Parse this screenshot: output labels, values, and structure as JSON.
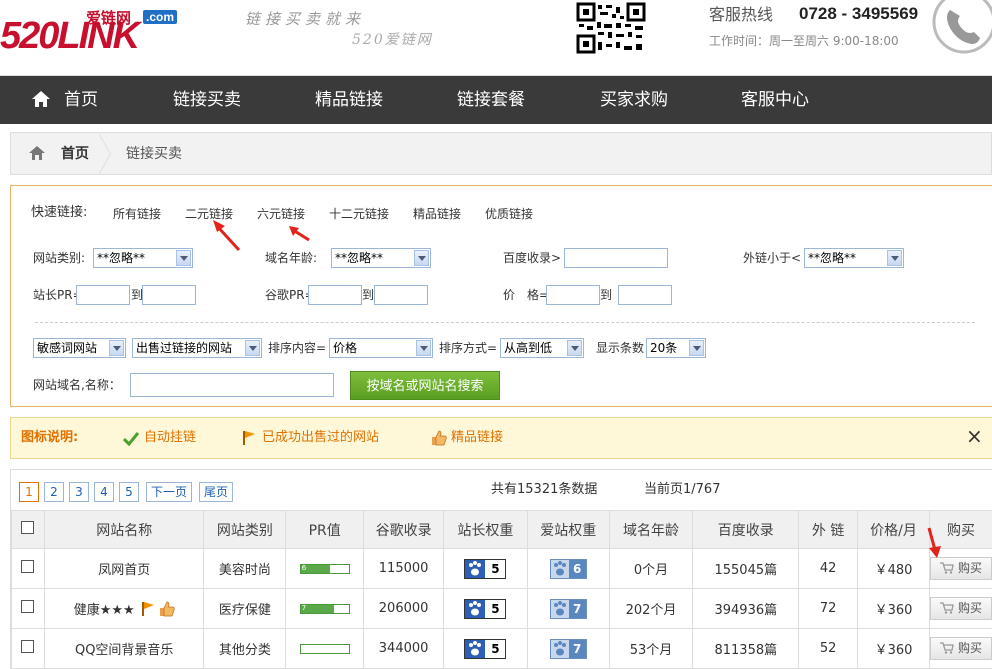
{
  "header": {
    "logo_main": "520LINK",
    "logo_cn": "爱链网",
    "logo_com": ".com",
    "slogan1": "链接买卖就来",
    "slogan2": "520爱链网",
    "hotline_label": "客服热线",
    "hotline_number": "0728 - 3495569",
    "work_time": "工作时间：周一至周六 9:00-18:00"
  },
  "nav": {
    "items": [
      {
        "label": "首页"
      },
      {
        "label": "链接买卖"
      },
      {
        "label": "精品链接"
      },
      {
        "label": "链接套餐"
      },
      {
        "label": "买家求购"
      },
      {
        "label": "客服中心"
      }
    ]
  },
  "breadcrumb": {
    "home": "首页",
    "current": "链接买卖"
  },
  "filter": {
    "quick_label": "快速链接:",
    "quick_links": [
      "所有链接",
      "二元链接",
      "六元链接",
      "十二元链接",
      "精品链接",
      "优质链接"
    ],
    "site_category_label": "网站类别:",
    "site_category_value": "**忽略**",
    "domain_age_label": "域名年龄:",
    "domain_age_value": "**忽略**",
    "baidu_index_label": "百度收录>",
    "outlinks_label": "外链小于<",
    "outlinks_value": "**忽略**",
    "pr_label": "站长PR=",
    "google_pr_label": "谷歌PR=",
    "price_label": "价　格=",
    "to": "到",
    "sensitive_value": "敏感词网站",
    "sold_value": "出售过链接的网站",
    "sort_content_label": "排序内容=",
    "sort_content_value": "价格",
    "sort_way_label": "排序方式=",
    "sort_way_value": "从高到低",
    "show_count_label": "显示条数",
    "show_count_value": "20条",
    "domain_label": "网站域名,名称：",
    "search_button": "按域名或网站名搜索"
  },
  "legend": {
    "title": "图标说明:",
    "items": [
      "自动挂链",
      "已成功出售过的网站",
      "精品链接"
    ],
    "close": "×"
  },
  "pagination": {
    "pages": [
      "1",
      "2",
      "3",
      "4",
      "5"
    ],
    "next": "下一页",
    "last": "尾页",
    "total": "共有15321条数据",
    "current": "当前页1/767"
  },
  "table": {
    "headers": [
      "网站名称",
      "网站类别",
      "PR值",
      "谷歌收录",
      "站长权重",
      "爱站权重",
      "域名年龄",
      "百度收录",
      "外 链",
      "价格/月",
      "购买"
    ],
    "buy_label": "购买",
    "rows": [
      {
        "name": "凤网首页",
        "category": "美容时尚",
        "pr": 6,
        "google": "115000",
        "bd_weight": "5",
        "az_weight": "6",
        "age": "0个月",
        "baidu": "155045篇",
        "links": "42",
        "price": "￥480"
      },
      {
        "name": "健康★★★",
        "category": "医疗保健",
        "pr": 7,
        "google": "206000",
        "bd_weight": "5",
        "az_weight": "7",
        "age": "202个月",
        "baidu": "394936篇",
        "links": "72",
        "price": "￥360"
      },
      {
        "name": "QQ空间背景音乐",
        "category": "其他分类",
        "pr": 0,
        "google": "344000",
        "bd_weight": "5",
        "az_weight": "7",
        "age": "53个月",
        "baidu": "811358篇",
        "links": "52",
        "price": "￥360"
      }
    ]
  },
  "colors": {
    "brand_red": "#c8102e",
    "nav_bg": "#3a3a3a",
    "legend_orange": "#e07000",
    "search_green": "#5a9e22"
  }
}
